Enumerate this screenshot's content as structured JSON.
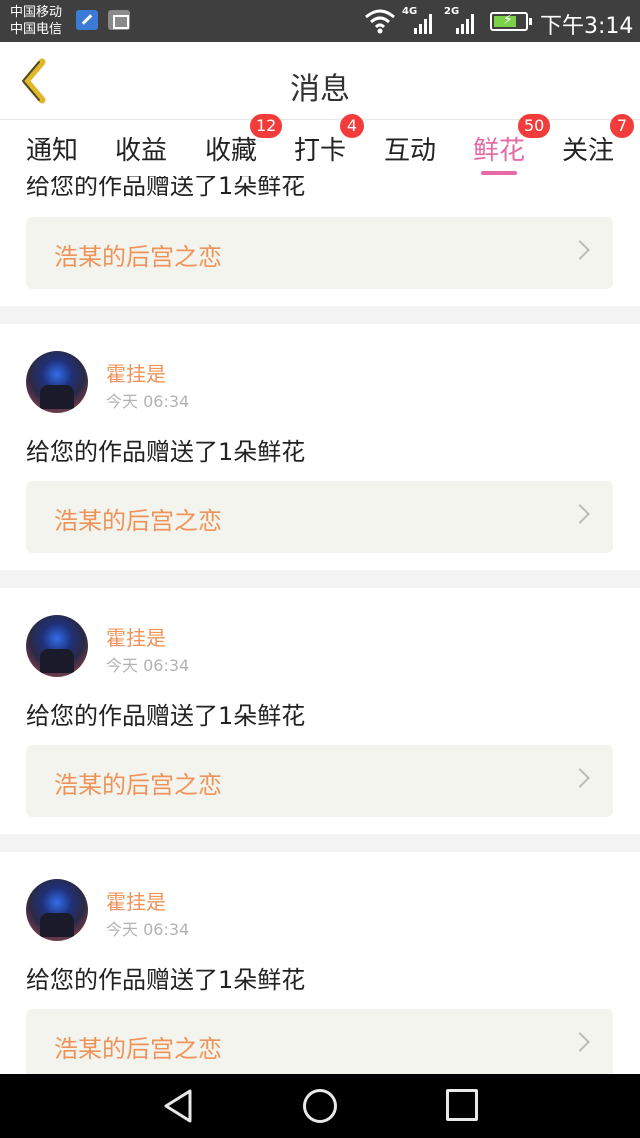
{
  "status_bar": {
    "carrier_1": "中国移动",
    "carrier_2": "中国电信",
    "net_1": "4G",
    "net_2": "2G",
    "time": "下午3:14",
    "battery_color": "#7dd14a"
  },
  "header": {
    "title": "消息",
    "back_icon": "chevron-left-icon",
    "accent": "#e2b62a"
  },
  "tabs": [
    {
      "label": "通知",
      "badge": ""
    },
    {
      "label": "收益",
      "badge": ""
    },
    {
      "label": "收藏",
      "badge": "12"
    },
    {
      "label": "打卡",
      "badge": "4"
    },
    {
      "label": "互动",
      "badge": ""
    },
    {
      "label": "鲜花",
      "badge": "50",
      "active": true
    },
    {
      "label": "关注",
      "badge": "7"
    }
  ],
  "feed": {
    "partial_item": {
      "message": "给您的作品赠送了1朵鲜花",
      "work_title": "浩某的后宫之恋"
    },
    "items": [
      {
        "user": "霍挂是",
        "time": "今天 06:34",
        "message": "给您的作品赠送了1朵鲜花",
        "work_title": "浩某的后宫之恋"
      },
      {
        "user": "霍挂是",
        "time": "今天 06:34",
        "message": "给您的作品赠送了1朵鲜花",
        "work_title": "浩某的后宫之恋"
      },
      {
        "user": "霍挂是",
        "time": "今天 06:34",
        "message": "给您的作品赠送了1朵鲜花",
        "work_title": "浩某的后宫之恋"
      }
    ]
  },
  "colors": {
    "active_tab": "#e76aa5",
    "badge": "#f23b3b",
    "username": "#f0935a",
    "work_title": "#f0935a",
    "work_card_bg": "#f4f4ee"
  },
  "nav_bar": {
    "back": "triangle-back-icon",
    "home": "circle-home-icon",
    "recent": "square-recent-icon"
  }
}
